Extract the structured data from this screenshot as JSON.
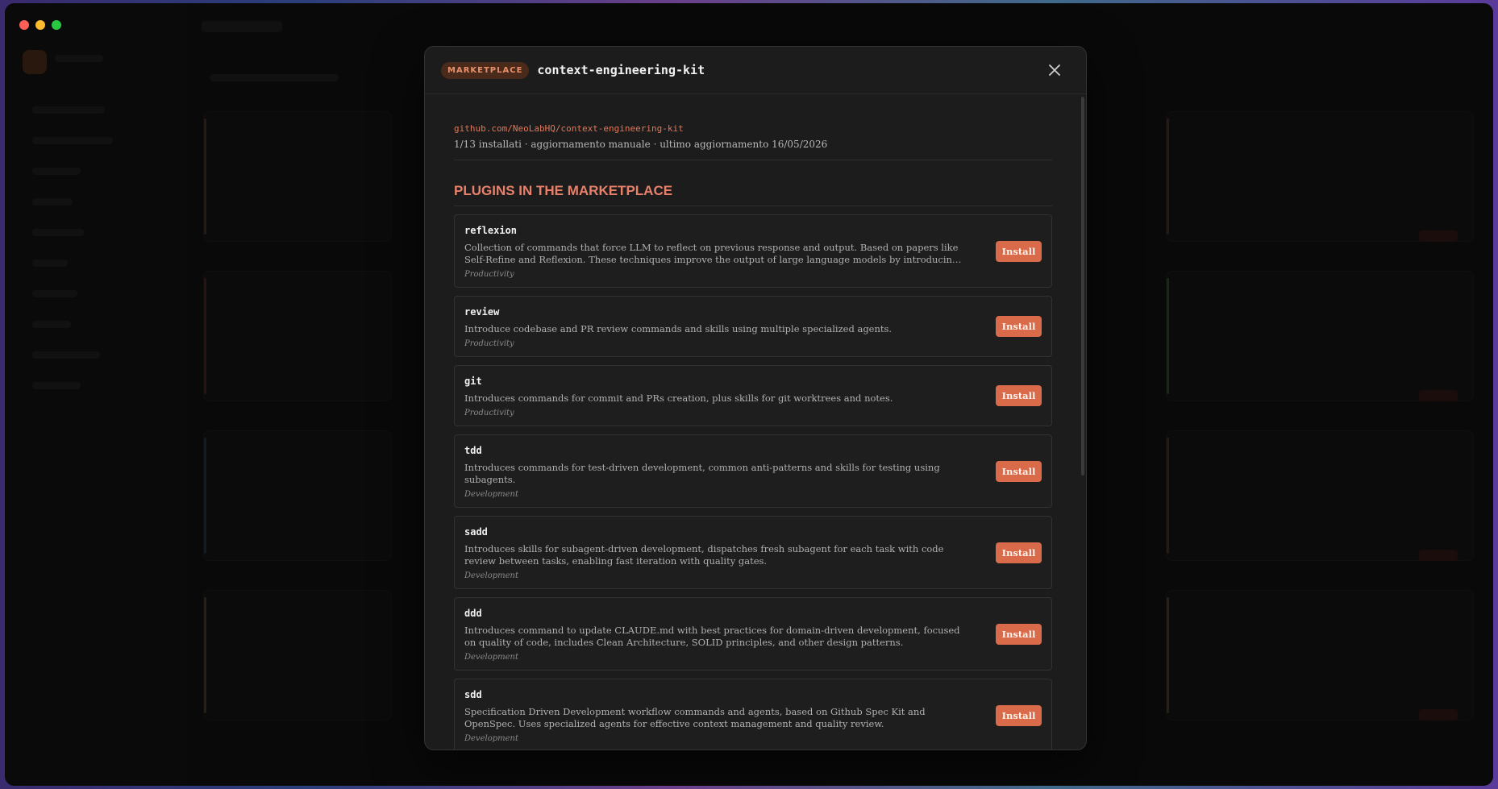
{
  "modal": {
    "badge": "MARKETPLACE",
    "title": "context-engineering-kit",
    "repo": "github.com/NeoLabHQ/context-engineering-kit",
    "meta": "1/13 installati · aggiornamento manuale · ultimo aggiornamento 16/05/2026",
    "section_title": "PLUGINS IN THE MARKETPLACE",
    "install_label": "Install",
    "plugins": [
      {
        "name": "reflexion",
        "description": "Collection of commands that force LLM to reflect on previous response and output. Based on papers like Self-Refine and Reflexion. These techniques improve the output of large language models by introducing feedback and refinement loops.",
        "category": "Productivity"
      },
      {
        "name": "review",
        "description": "Introduce codebase and PR review commands and skills using multiple specialized agents.",
        "category": "Productivity"
      },
      {
        "name": "git",
        "description": "Introduces commands for commit and PRs creation, plus skills for git worktrees and notes.",
        "category": "Productivity"
      },
      {
        "name": "tdd",
        "description": "Introduces commands for test-driven development, common anti-patterns and skills for testing using subagents.",
        "category": "Development"
      },
      {
        "name": "sadd",
        "description": "Introduces skills for subagent-driven development, dispatches fresh subagent for each task with code review between tasks, enabling fast iteration with quality gates.",
        "category": "Development"
      },
      {
        "name": "ddd",
        "description": "Introduces command to update CLAUDE.md with best practices for domain-driven development, focused on quality of code, includes Clean Architecture, SOLID principles, and other design patterns.",
        "category": "Development"
      },
      {
        "name": "sdd",
        "description": "Specification Driven Development workflow commands and agents, based on Github Spec Kit and OpenSpec. Uses specialized agents for effective context management and quality review.",
        "category": "Development"
      }
    ]
  },
  "colors": {
    "accent": "#d96a4a",
    "badge_bg": "#4a2a1a",
    "window_bg": "#141414"
  }
}
